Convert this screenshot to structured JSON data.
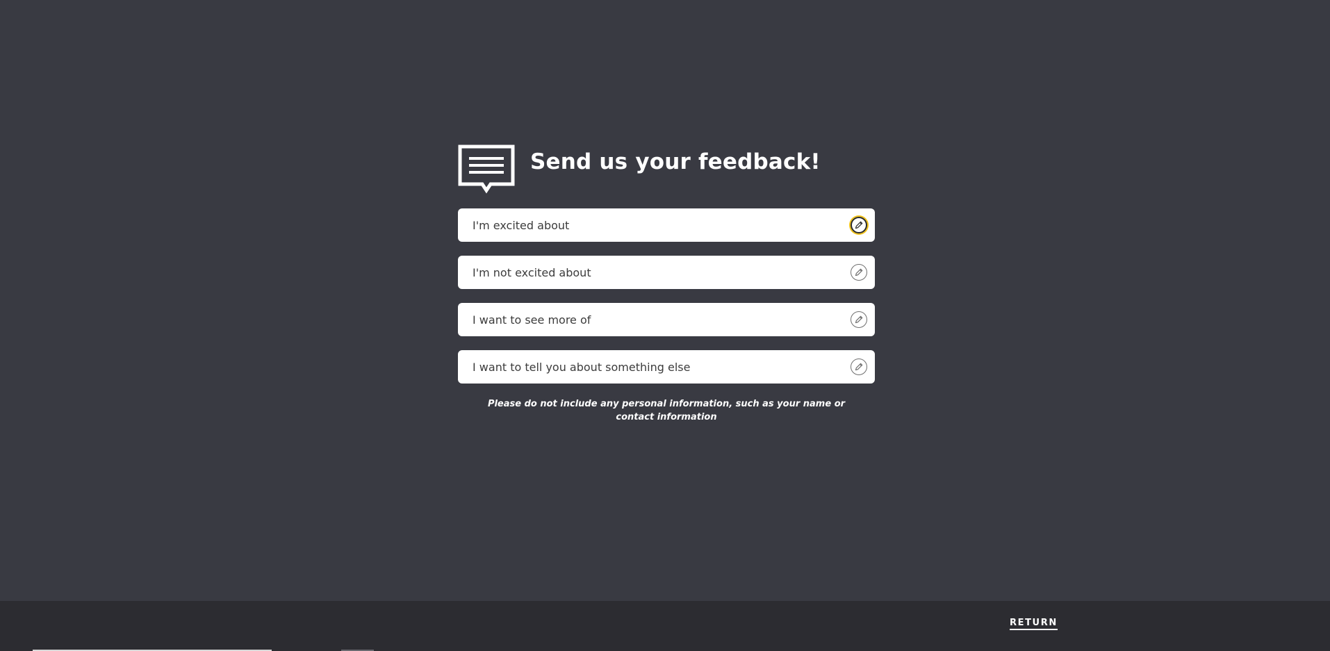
{
  "header": {
    "title": "Send us your feedback!",
    "icon": "chat-bubble-icon"
  },
  "options": [
    {
      "label": "I'm excited about",
      "icon": "pencil-icon",
      "focused": true
    },
    {
      "label": "I'm not excited about",
      "icon": "pencil-icon",
      "focused": false
    },
    {
      "label": "I want to see more of",
      "icon": "pencil-icon",
      "focused": false
    },
    {
      "label": "I want to tell you about something else",
      "icon": "pencil-icon",
      "focused": false
    }
  ],
  "disclaimer": "Please do not include any personal information, such as your name or contact information",
  "footer": {
    "return_label": "RETURN"
  },
  "colors": {
    "background": "#393a42",
    "footer": "#2c2c31",
    "focus_ring": "#f2c318",
    "text_on_dark": "#ffffff"
  }
}
